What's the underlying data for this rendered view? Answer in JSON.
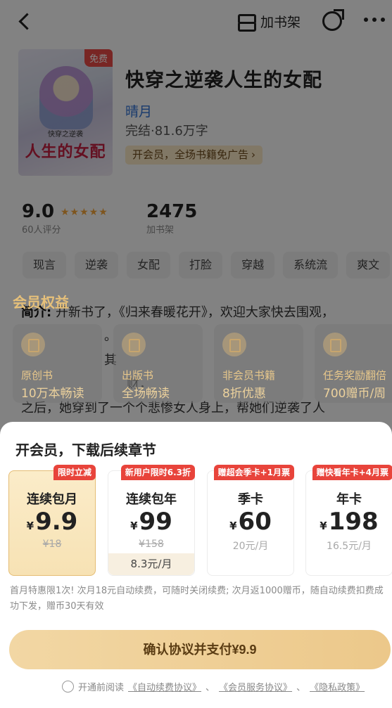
{
  "header": {
    "shelf_label": "加书架"
  },
  "book": {
    "cover_badge": "免费",
    "cover_title": "人生的女配",
    "cover_subtitle": "快穿之逆袭",
    "title": "快穿之逆袭人生的女配",
    "author": "晴月",
    "status": "完结·81.6万字",
    "vip_chip": "开会员，全场书籍免广告",
    "vip_chip_arrow": "›"
  },
  "stats": {
    "rating": "9.0",
    "stars": "★★★★★",
    "rating_count": "60人评分",
    "shelf_count": "2475",
    "shelf_count_label": "加书架"
  },
  "tags": [
    "现言",
    "逆袭",
    "女配",
    "打脸",
    "穿越",
    "系统流",
    "爽文"
  ],
  "intro": {
    "label": "简介:",
    "line1": "开新书了，《归来春暖花开》，欢迎大家快去围观，",
    "line2": "。",
    "line3": "其",
    "line4": "财，",
    "line5": "之后，她穿到了一个个悲惨女人身上，帮她们逆袭了人"
  },
  "benefits": {
    "title": "会员权益",
    "items": [
      {
        "icon": "book-icon",
        "line1": "原创书",
        "line2": "10万本畅读"
      },
      {
        "icon": "open-book-icon",
        "line1": "出版书",
        "line2": "全场畅读"
      },
      {
        "icon": "yen-shield-icon",
        "line1": "非会员书籍",
        "line2": "8折优惠"
      },
      {
        "icon": "gift-icon",
        "line1": "任务奖励翻倍",
        "line2": "700赠币/周"
      }
    ]
  },
  "sheet": {
    "title": "开会员，下载后续章节",
    "plans": [
      {
        "ribbon": "限时立减",
        "name": "连续包月",
        "currency": "¥",
        "price": "9.9",
        "sub": "¥18",
        "strike": true,
        "selected": true
      },
      {
        "ribbon": "新用户限时6.3折",
        "name": "连续包年",
        "currency": "¥",
        "price": "99",
        "sub": "¥158",
        "strike": true,
        "foot": "8.3元/月"
      },
      {
        "ribbon": "赠超会季卡+1月票",
        "name": "季卡",
        "currency": "¥",
        "price": "60",
        "sub": "20元/月",
        "strike": false
      },
      {
        "ribbon": "赠快看年卡+4月票",
        "name": "年卡",
        "currency": "¥",
        "price": "198",
        "sub": "16.5元/月",
        "strike": false
      }
    ],
    "notice": "首月特惠限1次! 次月18元自动续费，可随时关闭续费; 次月返1000赠币，随自动续费扣费成功下发，赠币30天有效",
    "pay_button": "确认协议并支付¥9.9",
    "agree_prefix": "开通前阅读",
    "agree_link1": "《自动续费协议》",
    "agree_sep1": "、",
    "agree_link2": "《会员服务协议》",
    "agree_sep2": "、",
    "agree_link3": "《隐私政策》"
  }
}
